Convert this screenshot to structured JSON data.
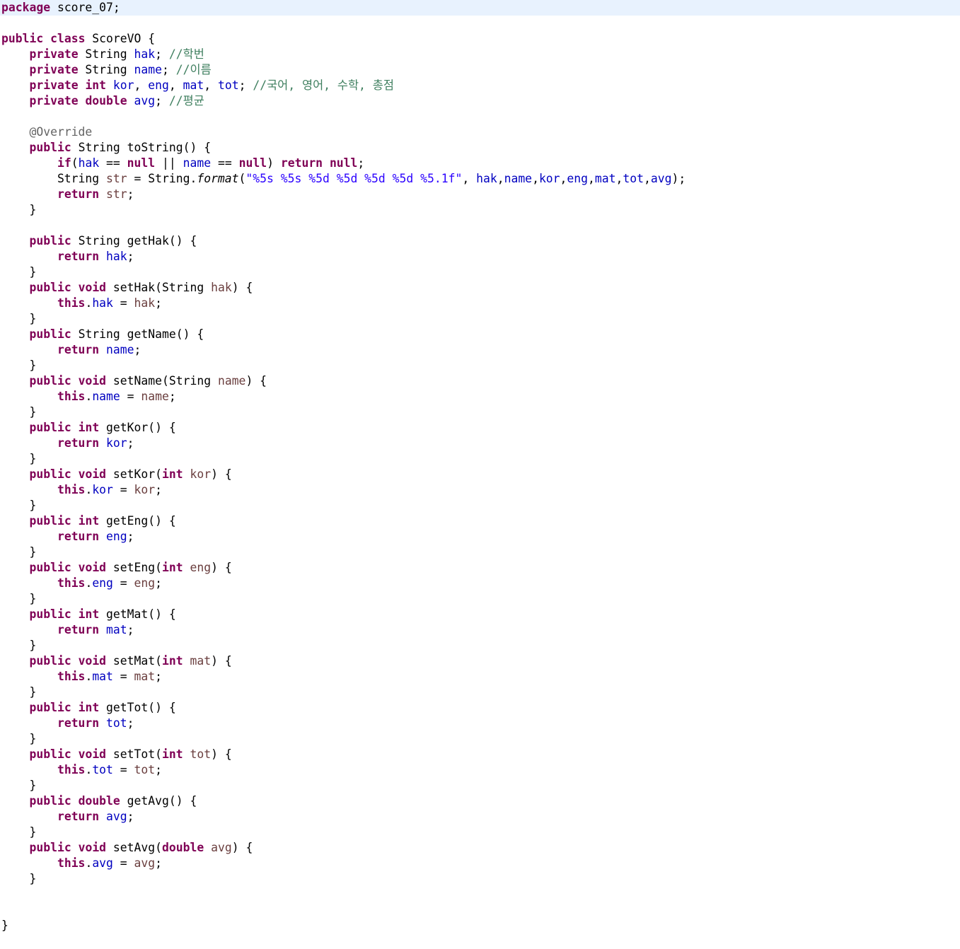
{
  "editor": {
    "current_line_color": "#e8f2fe",
    "syntax_colors": {
      "keyword": "#7f0055",
      "field": "#0000c0",
      "comment": "#3f7f5f",
      "string": "#2a00ff",
      "annotation": "#646464",
      "parameter": "#6a3e3e"
    },
    "lines": [
      [
        [
          "keyword",
          "package"
        ],
        [
          "plain",
          " score_07;"
        ]
      ],
      [],
      [
        [
          "keyword",
          "public"
        ],
        [
          "plain",
          " "
        ],
        [
          "keyword",
          "class"
        ],
        [
          "plain",
          " ScoreVO {"
        ]
      ],
      [
        [
          "plain",
          "    "
        ],
        [
          "keyword",
          "private"
        ],
        [
          "plain",
          " String "
        ],
        [
          "field",
          "hak"
        ],
        [
          "plain",
          "; "
        ],
        [
          "comment",
          "//학번"
        ]
      ],
      [
        [
          "plain",
          "    "
        ],
        [
          "keyword",
          "private"
        ],
        [
          "plain",
          " String "
        ],
        [
          "field",
          "name"
        ],
        [
          "plain",
          "; "
        ],
        [
          "comment",
          "//이름"
        ]
      ],
      [
        [
          "plain",
          "    "
        ],
        [
          "keyword",
          "private"
        ],
        [
          "plain",
          " "
        ],
        [
          "keyword",
          "int"
        ],
        [
          "plain",
          " "
        ],
        [
          "field",
          "kor"
        ],
        [
          "plain",
          ", "
        ],
        [
          "field",
          "eng"
        ],
        [
          "plain",
          ", "
        ],
        [
          "field",
          "mat"
        ],
        [
          "plain",
          ", "
        ],
        [
          "field",
          "tot"
        ],
        [
          "plain",
          "; "
        ],
        [
          "comment",
          "//국어, 영어, 수학, 총점"
        ]
      ],
      [
        [
          "plain",
          "    "
        ],
        [
          "keyword",
          "private"
        ],
        [
          "plain",
          " "
        ],
        [
          "keyword",
          "double"
        ],
        [
          "plain",
          " "
        ],
        [
          "field",
          "avg"
        ],
        [
          "plain",
          "; "
        ],
        [
          "comment",
          "//평균"
        ]
      ],
      [],
      [
        [
          "plain",
          "    "
        ],
        [
          "annotation",
          "@Override"
        ]
      ],
      [
        [
          "plain",
          "    "
        ],
        [
          "keyword",
          "public"
        ],
        [
          "plain",
          " String toString() {"
        ]
      ],
      [
        [
          "plain",
          "        "
        ],
        [
          "keyword",
          "if"
        ],
        [
          "plain",
          "("
        ],
        [
          "field",
          "hak"
        ],
        [
          "plain",
          " == "
        ],
        [
          "keyword",
          "null"
        ],
        [
          "plain",
          " || "
        ],
        [
          "field",
          "name"
        ],
        [
          "plain",
          " == "
        ],
        [
          "keyword",
          "null"
        ],
        [
          "plain",
          ") "
        ],
        [
          "keyword",
          "return"
        ],
        [
          "plain",
          " "
        ],
        [
          "keyword",
          "null"
        ],
        [
          "plain",
          ";"
        ]
      ],
      [
        [
          "plain",
          "        String "
        ],
        [
          "param",
          "str"
        ],
        [
          "plain",
          " = String."
        ],
        [
          "static",
          "format"
        ],
        [
          "plain",
          "("
        ],
        [
          "string",
          "\"%5s %5s %5d %5d %5d %5d %5.1f\""
        ],
        [
          "plain",
          ", "
        ],
        [
          "field",
          "hak"
        ],
        [
          "plain",
          ","
        ],
        [
          "field",
          "name"
        ],
        [
          "plain",
          ","
        ],
        [
          "field",
          "kor"
        ],
        [
          "plain",
          ","
        ],
        [
          "field",
          "eng"
        ],
        [
          "plain",
          ","
        ],
        [
          "field",
          "mat"
        ],
        [
          "plain",
          ","
        ],
        [
          "field",
          "tot"
        ],
        [
          "plain",
          ","
        ],
        [
          "field",
          "avg"
        ],
        [
          "plain",
          ");"
        ]
      ],
      [
        [
          "plain",
          "        "
        ],
        [
          "keyword",
          "return"
        ],
        [
          "plain",
          " "
        ],
        [
          "param",
          "str"
        ],
        [
          "plain",
          ";"
        ]
      ],
      [
        [
          "plain",
          "    }"
        ]
      ],
      [],
      [
        [
          "plain",
          "    "
        ],
        [
          "keyword",
          "public"
        ],
        [
          "plain",
          " String getHak() {"
        ]
      ],
      [
        [
          "plain",
          "        "
        ],
        [
          "keyword",
          "return"
        ],
        [
          "plain",
          " "
        ],
        [
          "field",
          "hak"
        ],
        [
          "plain",
          ";"
        ]
      ],
      [
        [
          "plain",
          "    }"
        ]
      ],
      [
        [
          "plain",
          "    "
        ],
        [
          "keyword",
          "public"
        ],
        [
          "plain",
          " "
        ],
        [
          "keyword",
          "void"
        ],
        [
          "plain",
          " setHak(String "
        ],
        [
          "param",
          "hak"
        ],
        [
          "plain",
          ") {"
        ]
      ],
      [
        [
          "plain",
          "        "
        ],
        [
          "keyword",
          "this"
        ],
        [
          "plain",
          "."
        ],
        [
          "field",
          "hak"
        ],
        [
          "plain",
          " = "
        ],
        [
          "param",
          "hak"
        ],
        [
          "plain",
          ";"
        ]
      ],
      [
        [
          "plain",
          "    }"
        ]
      ],
      [
        [
          "plain",
          "    "
        ],
        [
          "keyword",
          "public"
        ],
        [
          "plain",
          " String getName() {"
        ]
      ],
      [
        [
          "plain",
          "        "
        ],
        [
          "keyword",
          "return"
        ],
        [
          "plain",
          " "
        ],
        [
          "field",
          "name"
        ],
        [
          "plain",
          ";"
        ]
      ],
      [
        [
          "plain",
          "    }"
        ]
      ],
      [
        [
          "plain",
          "    "
        ],
        [
          "keyword",
          "public"
        ],
        [
          "plain",
          " "
        ],
        [
          "keyword",
          "void"
        ],
        [
          "plain",
          " setName(String "
        ],
        [
          "param",
          "name"
        ],
        [
          "plain",
          ") {"
        ]
      ],
      [
        [
          "plain",
          "        "
        ],
        [
          "keyword",
          "this"
        ],
        [
          "plain",
          "."
        ],
        [
          "field",
          "name"
        ],
        [
          "plain",
          " = "
        ],
        [
          "param",
          "name"
        ],
        [
          "plain",
          ";"
        ]
      ],
      [
        [
          "plain",
          "    }"
        ]
      ],
      [
        [
          "plain",
          "    "
        ],
        [
          "keyword",
          "public"
        ],
        [
          "plain",
          " "
        ],
        [
          "keyword",
          "int"
        ],
        [
          "plain",
          " getKor() {"
        ]
      ],
      [
        [
          "plain",
          "        "
        ],
        [
          "keyword",
          "return"
        ],
        [
          "plain",
          " "
        ],
        [
          "field",
          "kor"
        ],
        [
          "plain",
          ";"
        ]
      ],
      [
        [
          "plain",
          "    }"
        ]
      ],
      [
        [
          "plain",
          "    "
        ],
        [
          "keyword",
          "public"
        ],
        [
          "plain",
          " "
        ],
        [
          "keyword",
          "void"
        ],
        [
          "plain",
          " setKor("
        ],
        [
          "keyword",
          "int"
        ],
        [
          "plain",
          " "
        ],
        [
          "param",
          "kor"
        ],
        [
          "plain",
          ") {"
        ]
      ],
      [
        [
          "plain",
          "        "
        ],
        [
          "keyword",
          "this"
        ],
        [
          "plain",
          "."
        ],
        [
          "field",
          "kor"
        ],
        [
          "plain",
          " = "
        ],
        [
          "param",
          "kor"
        ],
        [
          "plain",
          ";"
        ]
      ],
      [
        [
          "plain",
          "    }"
        ]
      ],
      [
        [
          "plain",
          "    "
        ],
        [
          "keyword",
          "public"
        ],
        [
          "plain",
          " "
        ],
        [
          "keyword",
          "int"
        ],
        [
          "plain",
          " getEng() {"
        ]
      ],
      [
        [
          "plain",
          "        "
        ],
        [
          "keyword",
          "return"
        ],
        [
          "plain",
          " "
        ],
        [
          "field",
          "eng"
        ],
        [
          "plain",
          ";"
        ]
      ],
      [
        [
          "plain",
          "    }"
        ]
      ],
      [
        [
          "plain",
          "    "
        ],
        [
          "keyword",
          "public"
        ],
        [
          "plain",
          " "
        ],
        [
          "keyword",
          "void"
        ],
        [
          "plain",
          " setEng("
        ],
        [
          "keyword",
          "int"
        ],
        [
          "plain",
          " "
        ],
        [
          "param",
          "eng"
        ],
        [
          "plain",
          ") {"
        ]
      ],
      [
        [
          "plain",
          "        "
        ],
        [
          "keyword",
          "this"
        ],
        [
          "plain",
          "."
        ],
        [
          "field",
          "eng"
        ],
        [
          "plain",
          " = "
        ],
        [
          "param",
          "eng"
        ],
        [
          "plain",
          ";"
        ]
      ],
      [
        [
          "plain",
          "    }"
        ]
      ],
      [
        [
          "plain",
          "    "
        ],
        [
          "keyword",
          "public"
        ],
        [
          "plain",
          " "
        ],
        [
          "keyword",
          "int"
        ],
        [
          "plain",
          " getMat() {"
        ]
      ],
      [
        [
          "plain",
          "        "
        ],
        [
          "keyword",
          "return"
        ],
        [
          "plain",
          " "
        ],
        [
          "field",
          "mat"
        ],
        [
          "plain",
          ";"
        ]
      ],
      [
        [
          "plain",
          "    }"
        ]
      ],
      [
        [
          "plain",
          "    "
        ],
        [
          "keyword",
          "public"
        ],
        [
          "plain",
          " "
        ],
        [
          "keyword",
          "void"
        ],
        [
          "plain",
          " setMat("
        ],
        [
          "keyword",
          "int"
        ],
        [
          "plain",
          " "
        ],
        [
          "param",
          "mat"
        ],
        [
          "plain",
          ") {"
        ]
      ],
      [
        [
          "plain",
          "        "
        ],
        [
          "keyword",
          "this"
        ],
        [
          "plain",
          "."
        ],
        [
          "field",
          "mat"
        ],
        [
          "plain",
          " = "
        ],
        [
          "param",
          "mat"
        ],
        [
          "plain",
          ";"
        ]
      ],
      [
        [
          "plain",
          "    }"
        ]
      ],
      [
        [
          "plain",
          "    "
        ],
        [
          "keyword",
          "public"
        ],
        [
          "plain",
          " "
        ],
        [
          "keyword",
          "int"
        ],
        [
          "plain",
          " getTot() {"
        ]
      ],
      [
        [
          "plain",
          "        "
        ],
        [
          "keyword",
          "return"
        ],
        [
          "plain",
          " "
        ],
        [
          "field",
          "tot"
        ],
        [
          "plain",
          ";"
        ]
      ],
      [
        [
          "plain",
          "    }"
        ]
      ],
      [
        [
          "plain",
          "    "
        ],
        [
          "keyword",
          "public"
        ],
        [
          "plain",
          " "
        ],
        [
          "keyword",
          "void"
        ],
        [
          "plain",
          " setTot("
        ],
        [
          "keyword",
          "int"
        ],
        [
          "plain",
          " "
        ],
        [
          "param",
          "tot"
        ],
        [
          "plain",
          ") {"
        ]
      ],
      [
        [
          "plain",
          "        "
        ],
        [
          "keyword",
          "this"
        ],
        [
          "plain",
          "."
        ],
        [
          "field",
          "tot"
        ],
        [
          "plain",
          " = "
        ],
        [
          "param",
          "tot"
        ],
        [
          "plain",
          ";"
        ]
      ],
      [
        [
          "plain",
          "    }"
        ]
      ],
      [
        [
          "plain",
          "    "
        ],
        [
          "keyword",
          "public"
        ],
        [
          "plain",
          " "
        ],
        [
          "keyword",
          "double"
        ],
        [
          "plain",
          " getAvg() {"
        ]
      ],
      [
        [
          "plain",
          "        "
        ],
        [
          "keyword",
          "return"
        ],
        [
          "plain",
          " "
        ],
        [
          "field",
          "avg"
        ],
        [
          "plain",
          ";"
        ]
      ],
      [
        [
          "plain",
          "    }"
        ]
      ],
      [
        [
          "plain",
          "    "
        ],
        [
          "keyword",
          "public"
        ],
        [
          "plain",
          " "
        ],
        [
          "keyword",
          "void"
        ],
        [
          "plain",
          " setAvg("
        ],
        [
          "keyword",
          "double"
        ],
        [
          "plain",
          " "
        ],
        [
          "param",
          "avg"
        ],
        [
          "plain",
          ") {"
        ]
      ],
      [
        [
          "plain",
          "        "
        ],
        [
          "keyword",
          "this"
        ],
        [
          "plain",
          "."
        ],
        [
          "field",
          "avg"
        ],
        [
          "plain",
          " = "
        ],
        [
          "param",
          "avg"
        ],
        [
          "plain",
          ";"
        ]
      ],
      [
        [
          "plain",
          "    }"
        ]
      ],
      [],
      [],
      [
        [
          "plain",
          "}"
        ]
      ]
    ]
  }
}
